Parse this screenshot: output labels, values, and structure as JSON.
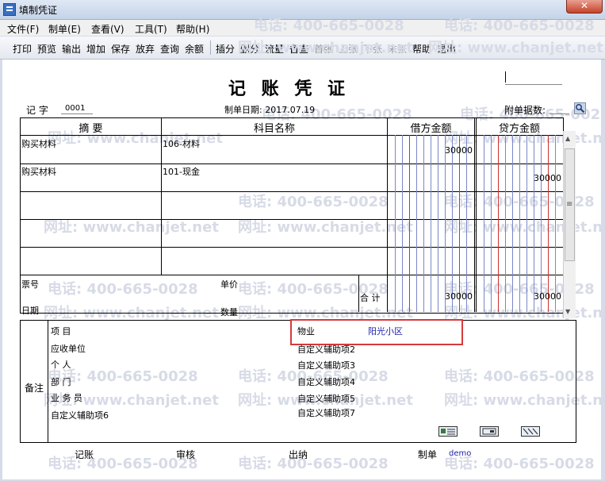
{
  "window": {
    "title": "填制凭证",
    "close_glyph": "✕"
  },
  "menu": [
    "文件(F)",
    "制单(E)",
    "查看(V)",
    "工具(T)",
    "帮助(H)"
  ],
  "toolbar": {
    "primary": [
      "打印",
      "预览",
      "输出",
      "增加",
      "保存",
      "放弃",
      "查询",
      "余额"
    ],
    "secondary": [
      "插分",
      "删分",
      "流量",
      "备查"
    ],
    "nav": [
      "首张",
      "上张",
      "下张",
      "末张"
    ],
    "end": [
      "帮助",
      "退出"
    ]
  },
  "voucher": {
    "title": "记 账 凭 证",
    "type_label": "记 字",
    "number": "0001",
    "date_label": "制单日期: 2017.07.19",
    "attach_label": "附单据数:",
    "headers": {
      "summary": "摘 要",
      "account": "科目名称",
      "debit": "借方金额",
      "credit": "贷方金额"
    },
    "rows": [
      {
        "summary": "购买材料",
        "account": "106-材料",
        "debit": "30000",
        "credit": ""
      },
      {
        "summary": "购买材料",
        "account": "101-现金",
        "debit": "",
        "credit": "30000"
      },
      {
        "summary": "",
        "account": "",
        "debit": "",
        "credit": ""
      },
      {
        "summary": "",
        "account": "",
        "debit": "",
        "credit": ""
      },
      {
        "summary": "",
        "account": "",
        "debit": "",
        "credit": ""
      }
    ],
    "footer": {
      "ticket_label": "票号",
      "date_label": "日期",
      "price_label": "单价",
      "qty_label": "数量",
      "total_label": "合 计",
      "total_debit": "30000",
      "total_credit": "30000"
    }
  },
  "remarks": {
    "label": "备注",
    "left": [
      "项 目",
      "应收单位",
      "个 人",
      "部 门",
      "业 务 员",
      "自定义辅助项6"
    ],
    "highlight_key": "物业",
    "highlight_value": "阳光小区",
    "right": [
      "自定义辅助项2",
      "自定义辅助项3",
      "自定义辅助项4",
      "自定义辅助项5",
      "自定义辅助项7"
    ]
  },
  "signatures": {
    "bookkeeping": "记账",
    "review": "审核",
    "cashier": "出纳",
    "maker_label": "制单",
    "maker_name": "demo"
  },
  "watermarks": [
    "电话: 400-665-0028",
    "网址: www.chanjet.net"
  ],
  "scroll_glyphs": {
    "up": "▲",
    "grip": "≡",
    "down": "▼"
  },
  "colors": {
    "highlight_border": "#d63a3a",
    "value_text": "#2222aa"
  }
}
